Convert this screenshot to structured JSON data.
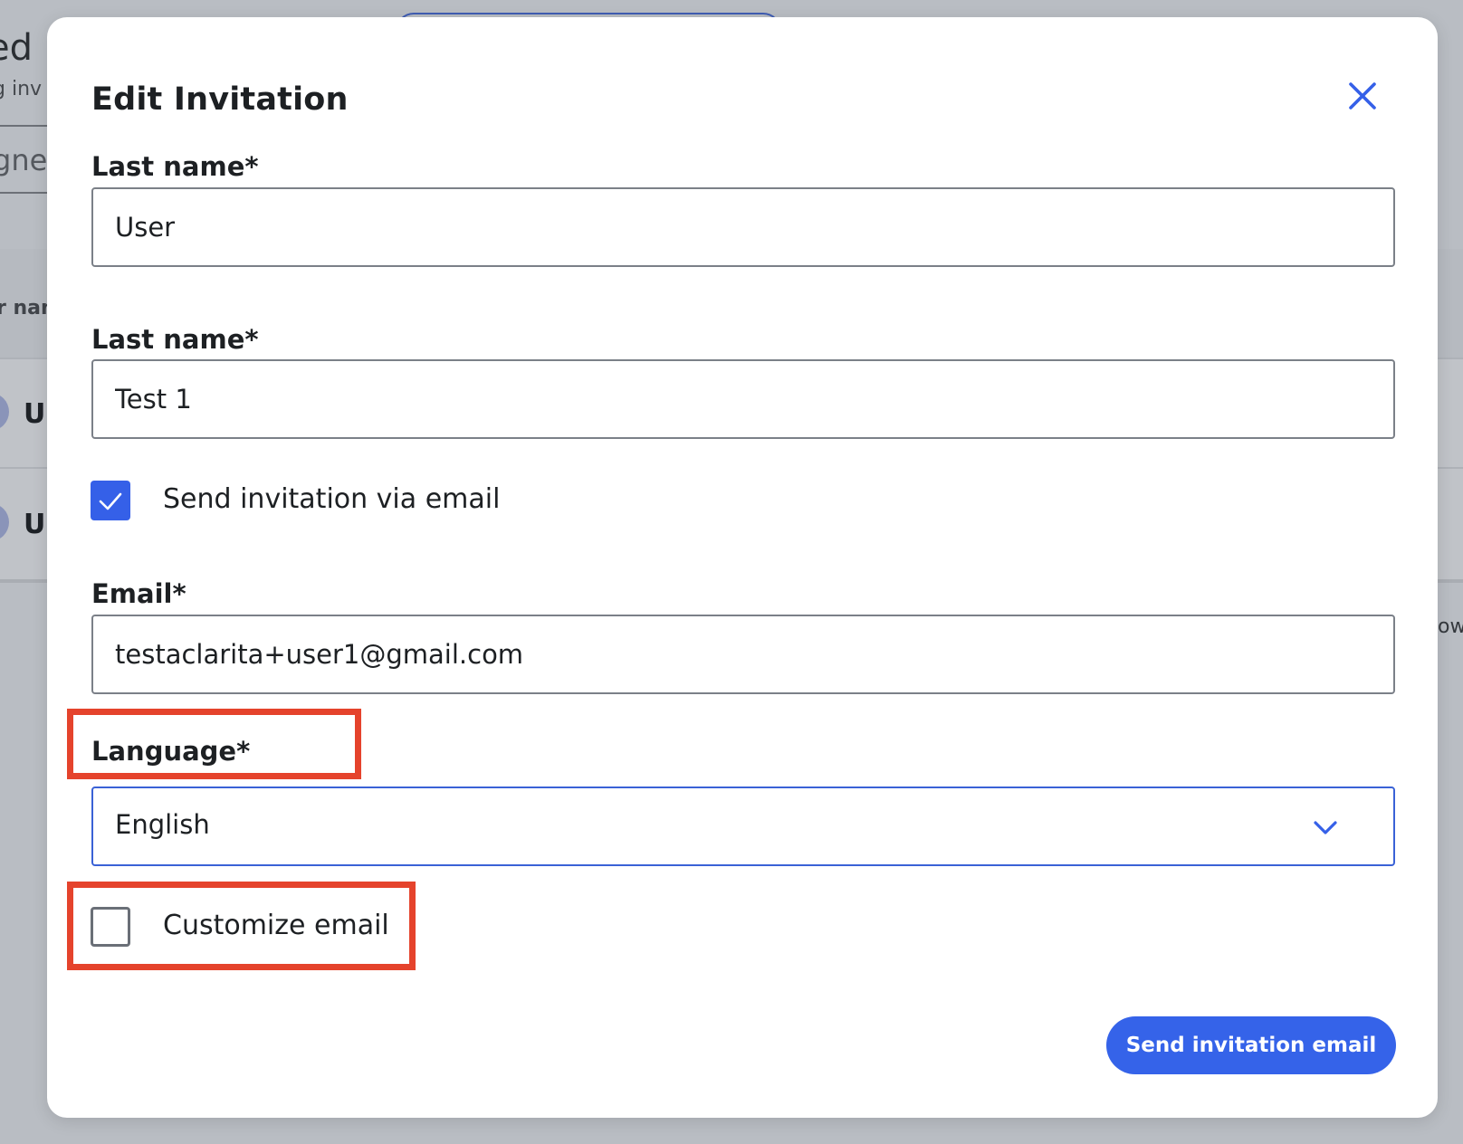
{
  "background": {
    "title_fragment": "ed u",
    "subtitle_fragment": "g inv",
    "field_fragment": "gned",
    "column_header_fragment": "r nam",
    "row1_letter": "U",
    "row2_letter": "U",
    "right_fragment": "ow"
  },
  "modal": {
    "title": "Edit Invitation",
    "close_icon": "close-icon",
    "fields": {
      "first_label": "Last name*",
      "first_value": "User",
      "second_label": "Last name*",
      "second_value": "Test 1",
      "send_via_email_label": "Send invitation via email",
      "send_via_email_checked": true,
      "email_label": "Email*",
      "email_value": "testaclarita+user1@gmail.com",
      "language_label": "Language*",
      "language_value": "English",
      "customize_label": "Customize email",
      "customize_checked": false
    },
    "primary_button": "Send invitation email"
  },
  "colors": {
    "accent": "#3563e9",
    "annotation": "#e5432c",
    "overlay": "#b9bdc3"
  }
}
